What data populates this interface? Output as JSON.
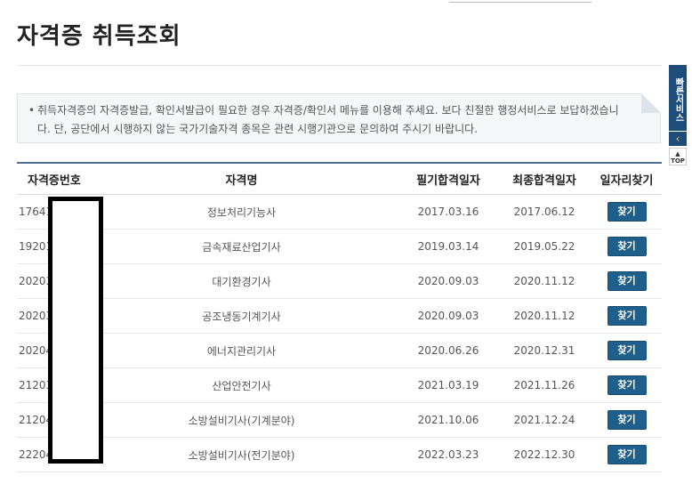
{
  "page": {
    "title": "자격증 취득조회"
  },
  "notice": {
    "bullet": "•",
    "text": "취득자격증의 자격증발급, 확인서발급이 필요한 경우 자격증/확인서 메뉴를 이용해 주세요. 보다 친절한 행정서비스로 보답하겠습니다. 단, 공단에서 시행하지 않는 국가기술자격 종목은 관련 시행기관으로 문의하여 주시기 바랍니다."
  },
  "table": {
    "headers": [
      "자격증번호",
      "자격명",
      "필기합격일자",
      "최종합격일자",
      "일자리찾기"
    ],
    "button_label": "찾기",
    "rows": [
      {
        "no": "17641",
        "name": "정보처리기능사",
        "written": "2017.03.16",
        "final": "2017.06.12"
      },
      {
        "no": "19201",
        "name": "금속재료산업기사",
        "written": "2019.03.14",
        "final": "2019.05.22"
      },
      {
        "no": "20203",
        "name": "대기환경기사",
        "written": "2020.09.03",
        "final": "2020.11.12"
      },
      {
        "no": "20203",
        "name": "공조냉동기계기사",
        "written": "2020.09.03",
        "final": "2020.11.12"
      },
      {
        "no": "20204",
        "name": "에너지관리기사",
        "written": "2020.06.26",
        "final": "2020.12.31"
      },
      {
        "no": "21203",
        "name": "산업안전기사",
        "written": "2021.03.19",
        "final": "2021.11.26"
      },
      {
        "no": "21204",
        "name": "소방설비기사(기계분야)",
        "written": "2021.10.06",
        "final": "2021.12.24"
      },
      {
        "no": "22204",
        "name": "소방설비기사(전기분야)",
        "written": "2022.03.23",
        "final": "2022.12.30"
      }
    ]
  },
  "side": {
    "quick_label": "빠른서비스",
    "arrow_icon": "chevron-left-icon",
    "arrow_glyph": "‹",
    "top_label": "TOP",
    "top_glyph": "▲"
  }
}
